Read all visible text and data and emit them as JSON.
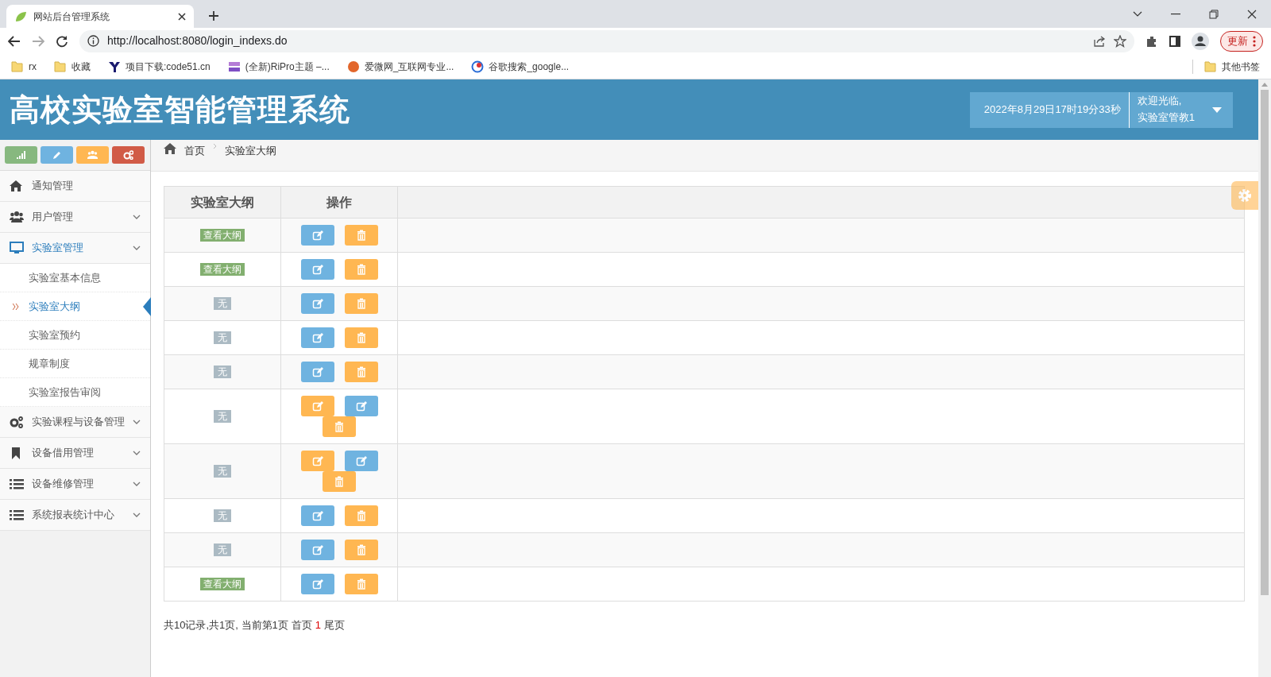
{
  "browser": {
    "tab_title": "网站后台管理系统",
    "url": "http://localhost:8080/login_indexs.do",
    "update_button": "更新",
    "bookmarks": [
      {
        "label": "rx",
        "kind": "folder"
      },
      {
        "label": "收藏",
        "kind": "folder"
      },
      {
        "label": "项目下载:code51.cn",
        "kind": "y"
      },
      {
        "label": "(全新)RiPro主题 –...",
        "kind": "zy"
      },
      {
        "label": "爱微网_互联网专业...",
        "kind": "ai"
      },
      {
        "label": "谷歌搜索_google...",
        "kind": "g"
      }
    ],
    "other_bookmarks": "其他书签"
  },
  "header": {
    "title": "高校实验室智能管理系统",
    "datetime": "2022年8月29日17时19分33秒",
    "welcome": "欢迎光临,",
    "user": "实验室管教1"
  },
  "shortcuts": [
    {
      "color": "#87b87f"
    },
    {
      "color": "#6fb3e0"
    },
    {
      "color": "#ffb752"
    },
    {
      "color": "#d15b47"
    }
  ],
  "sidebar": {
    "items": [
      {
        "label": "通知管理",
        "has_children": false,
        "expanded": false
      },
      {
        "label": "用户管理",
        "has_children": true,
        "expanded": false
      },
      {
        "label": "实验室管理",
        "has_children": true,
        "expanded": true,
        "children": [
          {
            "label": "实验室基本信息",
            "selected": false
          },
          {
            "label": "实验室大纲",
            "selected": true
          },
          {
            "label": "实验室预约",
            "selected": false
          },
          {
            "label": "规章制度",
            "selected": false
          },
          {
            "label": "实验室报告审阅",
            "selected": false
          }
        ]
      },
      {
        "label": "实验课程与设备管理",
        "has_children": true,
        "expanded": false
      },
      {
        "label": "设备借用管理",
        "has_children": true,
        "expanded": false
      },
      {
        "label": "设备维修管理",
        "has_children": true,
        "expanded": false
      },
      {
        "label": "系统报表统计中心",
        "has_children": true,
        "expanded": false
      }
    ]
  },
  "breadcrumb": [
    {
      "label": "首页"
    },
    {
      "label": "实验室大纲"
    }
  ],
  "table": {
    "columns": [
      "实验室大纲",
      "操作"
    ],
    "rows": [
      {
        "outline": {
          "kind": "view",
          "label": "查看大纲"
        },
        "buttons": [
          {
            "kind": "edit",
            "color": "#6fb3e0"
          },
          {
            "kind": "delete",
            "color": "#ffb752"
          }
        ]
      },
      {
        "outline": {
          "kind": "view",
          "label": "查看大纲"
        },
        "buttons": [
          {
            "kind": "edit",
            "color": "#6fb3e0"
          },
          {
            "kind": "delete",
            "color": "#ffb752"
          }
        ]
      },
      {
        "outline": {
          "kind": "none",
          "label": "无"
        },
        "buttons": [
          {
            "kind": "edit",
            "color": "#6fb3e0"
          },
          {
            "kind": "delete",
            "color": "#ffb752"
          }
        ]
      },
      {
        "outline": {
          "kind": "none",
          "label": "无"
        },
        "buttons": [
          {
            "kind": "edit",
            "color": "#6fb3e0"
          },
          {
            "kind": "delete",
            "color": "#ffb752"
          }
        ]
      },
      {
        "outline": {
          "kind": "none",
          "label": "无"
        },
        "buttons": [
          {
            "kind": "edit",
            "color": "#6fb3e0"
          },
          {
            "kind": "delete",
            "color": "#ffb752"
          }
        ]
      },
      {
        "outline": {
          "kind": "none",
          "label": "无"
        },
        "buttons": [
          {
            "kind": "edit",
            "color": "#ffb752"
          },
          {
            "kind": "edit",
            "color": "#6fb3e0"
          },
          {
            "kind": "delete",
            "color": "#ffb752"
          }
        ]
      },
      {
        "outline": {
          "kind": "none",
          "label": "无"
        },
        "buttons": [
          {
            "kind": "edit",
            "color": "#ffb752"
          },
          {
            "kind": "edit",
            "color": "#6fb3e0"
          },
          {
            "kind": "delete",
            "color": "#ffb752"
          }
        ]
      },
      {
        "outline": {
          "kind": "none",
          "label": "无"
        },
        "buttons": [
          {
            "kind": "edit",
            "color": "#6fb3e0"
          },
          {
            "kind": "delete",
            "color": "#ffb752"
          }
        ]
      },
      {
        "outline": {
          "kind": "none",
          "label": "无"
        },
        "buttons": [
          {
            "kind": "edit",
            "color": "#6fb3e0"
          },
          {
            "kind": "delete",
            "color": "#ffb752"
          }
        ]
      },
      {
        "outline": {
          "kind": "view",
          "label": "查看大纲"
        },
        "buttons": [
          {
            "kind": "edit",
            "color": "#6fb3e0"
          },
          {
            "kind": "delete",
            "color": "#ffb752"
          }
        ]
      }
    ]
  },
  "pagination": {
    "summary": "共10记录,共1页, 当前第1页",
    "first": "首页",
    "pages": [
      {
        "label": "1",
        "selected": true
      }
    ],
    "last": "尾页"
  }
}
